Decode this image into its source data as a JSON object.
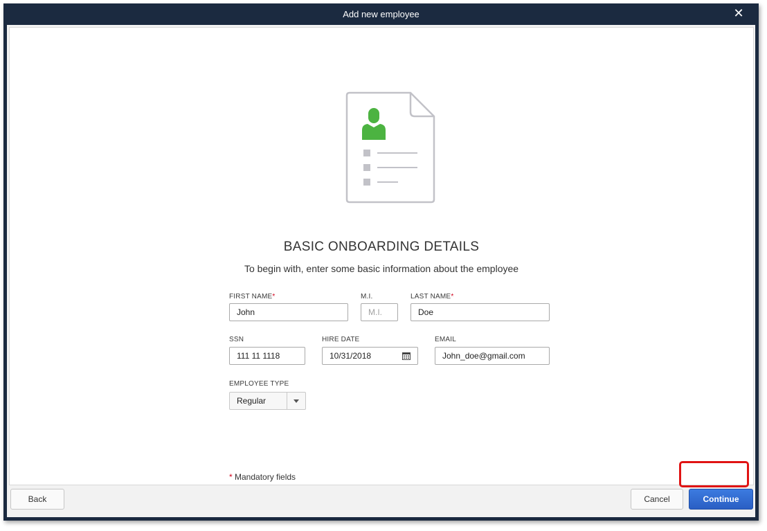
{
  "window": {
    "title": "Add new employee",
    "close_glyph": "✕"
  },
  "section": {
    "heading": "BASIC ONBOARDING DETAILS",
    "subheading": "To begin with, enter some basic information about the employee"
  },
  "form": {
    "first_name": {
      "label": "FIRST NAME",
      "required_mark": "*",
      "value": "John"
    },
    "middle_initial": {
      "label": "M.I.",
      "placeholder": "M.I."
    },
    "last_name": {
      "label": "LAST NAME",
      "required_mark": "*",
      "value": "Doe"
    },
    "ssn": {
      "label": "SSN",
      "value": "111 11 1118"
    },
    "hire_date": {
      "label": "HIRE DATE",
      "value": "10/31/2018",
      "icon": "calendar-icon"
    },
    "email": {
      "label": "EMAIL",
      "value": "John_doe@gmail.com"
    },
    "employee_type": {
      "label": "EMPLOYEE TYPE",
      "value": "Regular",
      "icon": "chevron-down-icon"
    }
  },
  "footer": {
    "mandatory_mark": "*",
    "mandatory_text": " Mandatory fields",
    "back_label": "Back",
    "cancel_label": "Cancel",
    "continue_label": "Continue"
  },
  "colors": {
    "titlebar": "#1b2a40",
    "accent_green": "#4cb341",
    "primary_button": "#2a5fc4",
    "highlight_red": "#e01313",
    "required_red": "#d0021b"
  }
}
